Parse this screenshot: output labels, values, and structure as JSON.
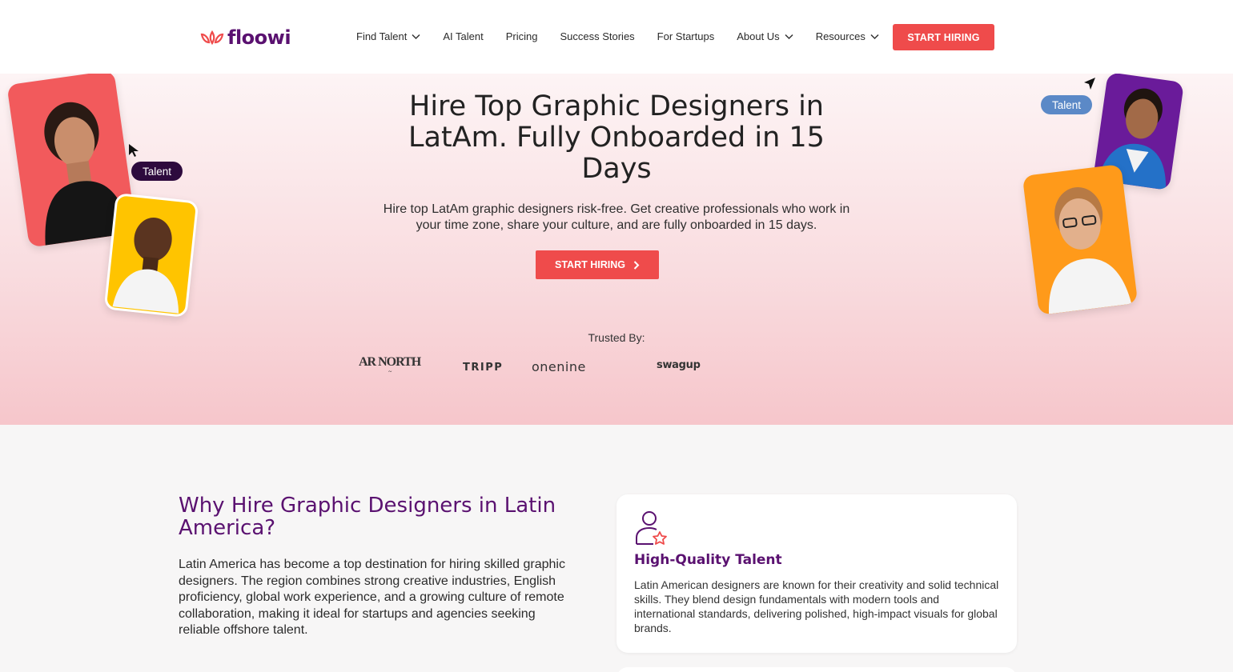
{
  "header": {
    "logo_text": "floowi",
    "nav": [
      {
        "label": "Find Talent",
        "dropdown": true
      },
      {
        "label": "AI Talent",
        "dropdown": false
      },
      {
        "label": "Pricing",
        "dropdown": false
      },
      {
        "label": "Success Stories",
        "dropdown": false
      },
      {
        "label": "For Startups",
        "dropdown": false
      },
      {
        "label": "About Us",
        "dropdown": true
      },
      {
        "label": "Resources",
        "dropdown": true
      }
    ],
    "cta_label": "START HIRING"
  },
  "hero": {
    "title": "Hire Top Graphic Designers in LatAm. Fully Onboarded in 15 Days",
    "subtitle": "Hire top LatAm graphic designers risk-free. Get creative professionals who work in your time zone, share your culture, and are fully onboarded in 15 days.",
    "cta_label": "START HIRING",
    "talent_tag_left": "Talent",
    "talent_tag_right": "Talent",
    "trusted_label": "Trusted By:",
    "brands": {
      "b1": "AR NORTH",
      "b2": "TRIPP",
      "b3": "onenine",
      "b4": "swagup"
    }
  },
  "why": {
    "title": "Why Hire Graphic Designers in Latin America?",
    "body": "Latin America has become a top destination for hiring skilled graphic designers. The region combines strong creative industries, English proficiency, global work experience, and a growing culture of remote collaboration, making it ideal for startups and agencies seeking reliable offshore talent.",
    "feature": {
      "icon": "user-star-icon",
      "title": "High-Quality Talent",
      "body": "Latin American designers are known for their creativity and solid technical skills. They blend design fundamentals with modern tools and international standards, delivering polished, high-impact visuals for global brands."
    }
  },
  "colors": {
    "brand_purple": "#5a1170",
    "cta_red": "#ef4b4b",
    "hero_pink": "#f6c6cb"
  }
}
